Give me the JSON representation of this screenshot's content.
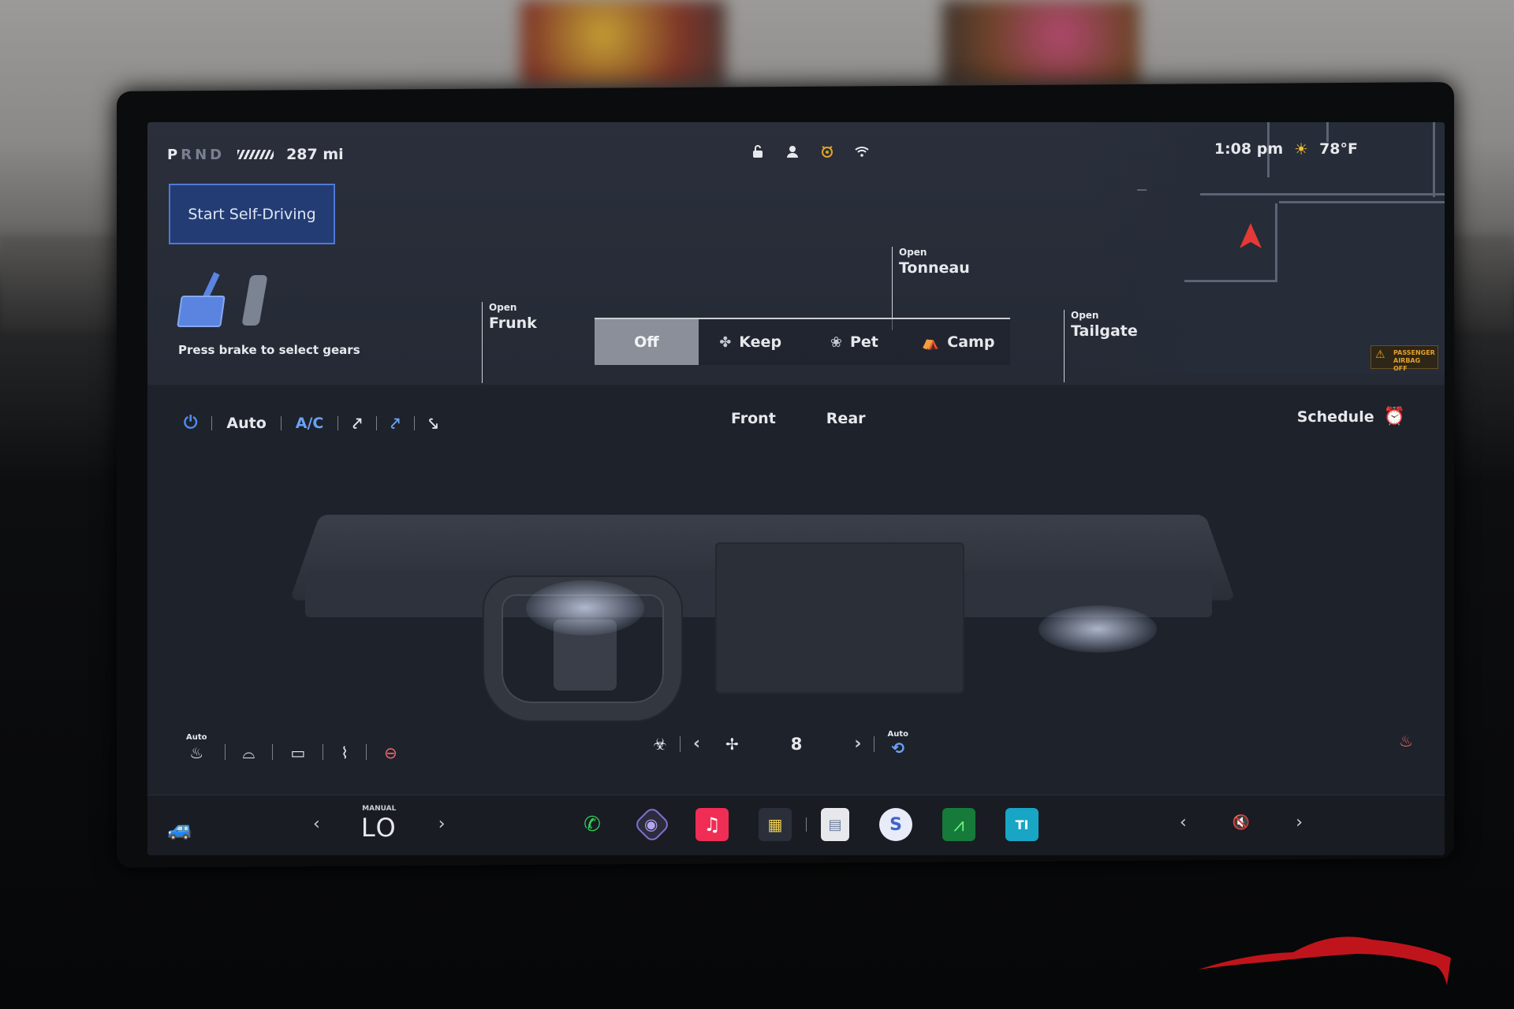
{
  "status": {
    "gears": [
      "P",
      "R",
      "N",
      "D"
    ],
    "active_gear": "P",
    "range": "287 mi",
    "time": "1:08 pm",
    "temperature": "78°F"
  },
  "self_driving": {
    "label": "Start Self-Driving"
  },
  "brake_hint": "Press brake to select gears",
  "openings": {
    "frunk": {
      "small": "Open",
      "big": "Frunk"
    },
    "tonneau": {
      "small": "Open",
      "big": "Tonneau"
    },
    "tailgate": {
      "small": "Open",
      "big": "Tailgate"
    }
  },
  "modes": [
    {
      "label": "Off",
      "icon": "",
      "active": true
    },
    {
      "label": "Keep",
      "icon": "fan-icon",
      "active": false
    },
    {
      "label": "Pet",
      "icon": "paw-icon",
      "active": false
    },
    {
      "label": "Camp",
      "icon": "tent-icon",
      "active": false
    }
  ],
  "airbag": {
    "line1": "PASSENGER",
    "line2": "AIRBAG OFF"
  },
  "climate": {
    "auto_label": "Auto",
    "ac_label": "A/C",
    "zones": [
      "Front",
      "Rear"
    ],
    "schedule_label": "Schedule",
    "seat_auto_label": "Auto",
    "fan_speed": "8",
    "recirc_auto_label": "Auto"
  },
  "dock": {
    "temp_mode": "MANUAL",
    "temp_value": "LO"
  },
  "colors": {
    "accent_blue": "#4e8cf0",
    "heat_red": "#f06a6a",
    "sentry_amber": "#e0a520"
  }
}
